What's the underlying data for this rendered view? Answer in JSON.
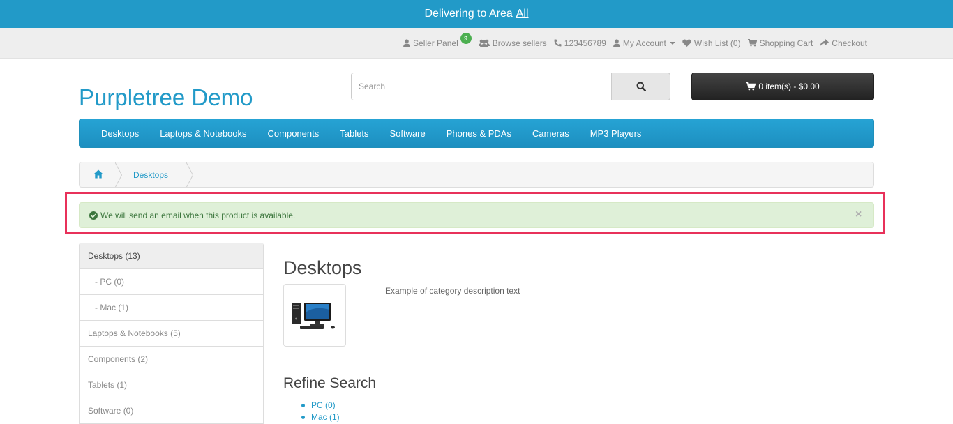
{
  "delivery": {
    "prefix": "Delivering to Area",
    "area": "All"
  },
  "topnav": {
    "seller_panel": "Seller Panel",
    "seller_badge": "9",
    "browse_sellers": "Browse sellers",
    "phone": "123456789",
    "my_account": "My Account",
    "wish_list": "Wish List (0)",
    "shopping_cart": "Shopping Cart",
    "checkout": "Checkout"
  },
  "header": {
    "logo": "Purpletree Demo",
    "search_placeholder": "Search",
    "cart_label": "0 item(s) - $0.00"
  },
  "menu": [
    "Desktops",
    "Laptops & Notebooks",
    "Components",
    "Tablets",
    "Software",
    "Phones & PDAs",
    "Cameras",
    "MP3 Players"
  ],
  "breadcrumb": {
    "current": "Desktops"
  },
  "alert": {
    "message": "We will send an email when this product is available.",
    "close": "×"
  },
  "sidebar": {
    "items": [
      {
        "label": "Desktops (13)"
      },
      {
        "label": "- PC (0)"
      },
      {
        "label": "- Mac (1)"
      },
      {
        "label": "Laptops & Notebooks (5)"
      },
      {
        "label": "Components (2)"
      },
      {
        "label": "Tablets (1)"
      },
      {
        "label": "Software (0)"
      }
    ]
  },
  "main": {
    "title": "Desktops",
    "description": "Example of category description text",
    "refine_title": "Refine Search",
    "refine_items": [
      "PC (0)",
      "Mac (1)"
    ]
  },
  "colors": {
    "brand": "#229ac8",
    "highlight": "#e8315a",
    "alert_bg": "#dff0d8",
    "alert_text": "#3c763d"
  }
}
